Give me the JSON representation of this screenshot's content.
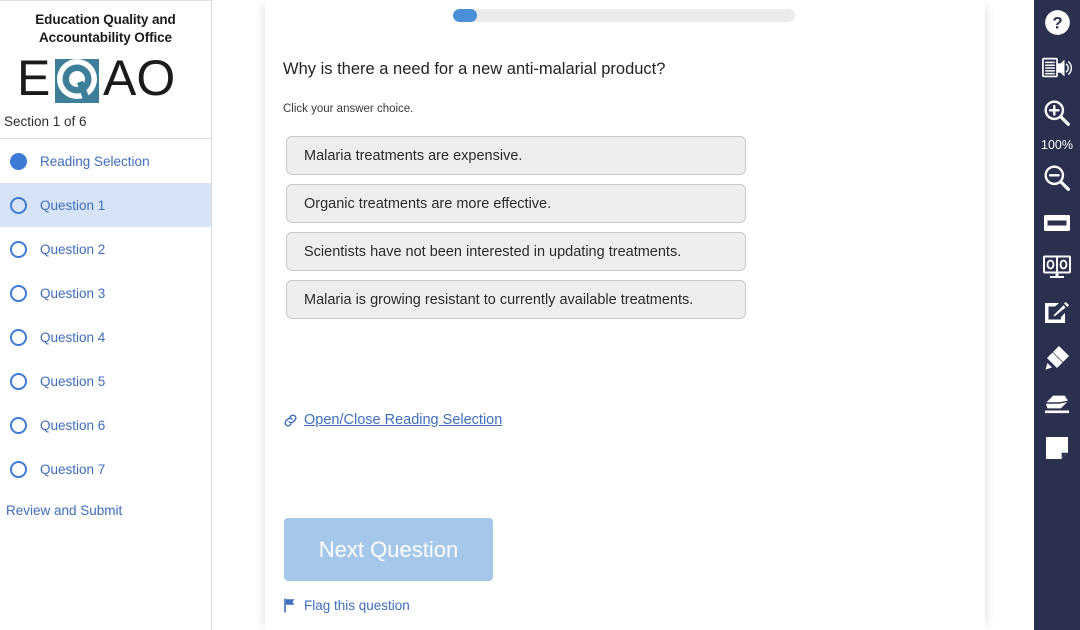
{
  "sidebar": {
    "brand_name": "Education Quality and Accountability Office",
    "logo_text": "EQAO",
    "section_label": "Section 1 of 6",
    "items": [
      {
        "label": "Reading Selection",
        "state": "filled",
        "selected": false
      },
      {
        "label": "Question 1",
        "state": "empty",
        "selected": true
      },
      {
        "label": "Question 2",
        "state": "empty",
        "selected": false
      },
      {
        "label": "Question 3",
        "state": "empty",
        "selected": false
      },
      {
        "label": "Question 4",
        "state": "empty",
        "selected": false
      },
      {
        "label": "Question 5",
        "state": "empty",
        "selected": false
      },
      {
        "label": "Question 6",
        "state": "empty",
        "selected": false
      },
      {
        "label": "Question 7",
        "state": "empty",
        "selected": false
      }
    ],
    "review_label": "Review and Submit"
  },
  "content": {
    "progress_percent": 7,
    "question": "Why is there a need for a new anti-malarial product?",
    "instruction": "Click your answer choice.",
    "choices": [
      "Malaria treatments are expensive.",
      "Organic treatments are more effective.",
      "Scientists have not been interested in updating treatments.",
      "Malaria is growing resistant to currently available treatments."
    ],
    "reading_link_label": "Open/Close Reading Selection",
    "next_button_label": "Next Question",
    "flag_label": "Flag this question"
  },
  "toolbar": {
    "zoom_level": "100%",
    "tools": [
      "help-icon",
      "text-to-speech-icon",
      "zoom-in-icon",
      "zoom-out-icon",
      "line-reader-icon",
      "split-screen-icon",
      "edit-pencil-icon",
      "highlighter-icon",
      "eraser-icon",
      "sticky-note-icon"
    ]
  },
  "colors": {
    "accent_blue": "#3d7bd6",
    "link_blue": "#3f6ebd",
    "selected_row": "#d7e4f7",
    "toolbar_bg": "#2b304e",
    "logo_teal": "#3d7f99",
    "button_blue": "#a5c8ea",
    "choice_bg": "#eeeeee"
  }
}
